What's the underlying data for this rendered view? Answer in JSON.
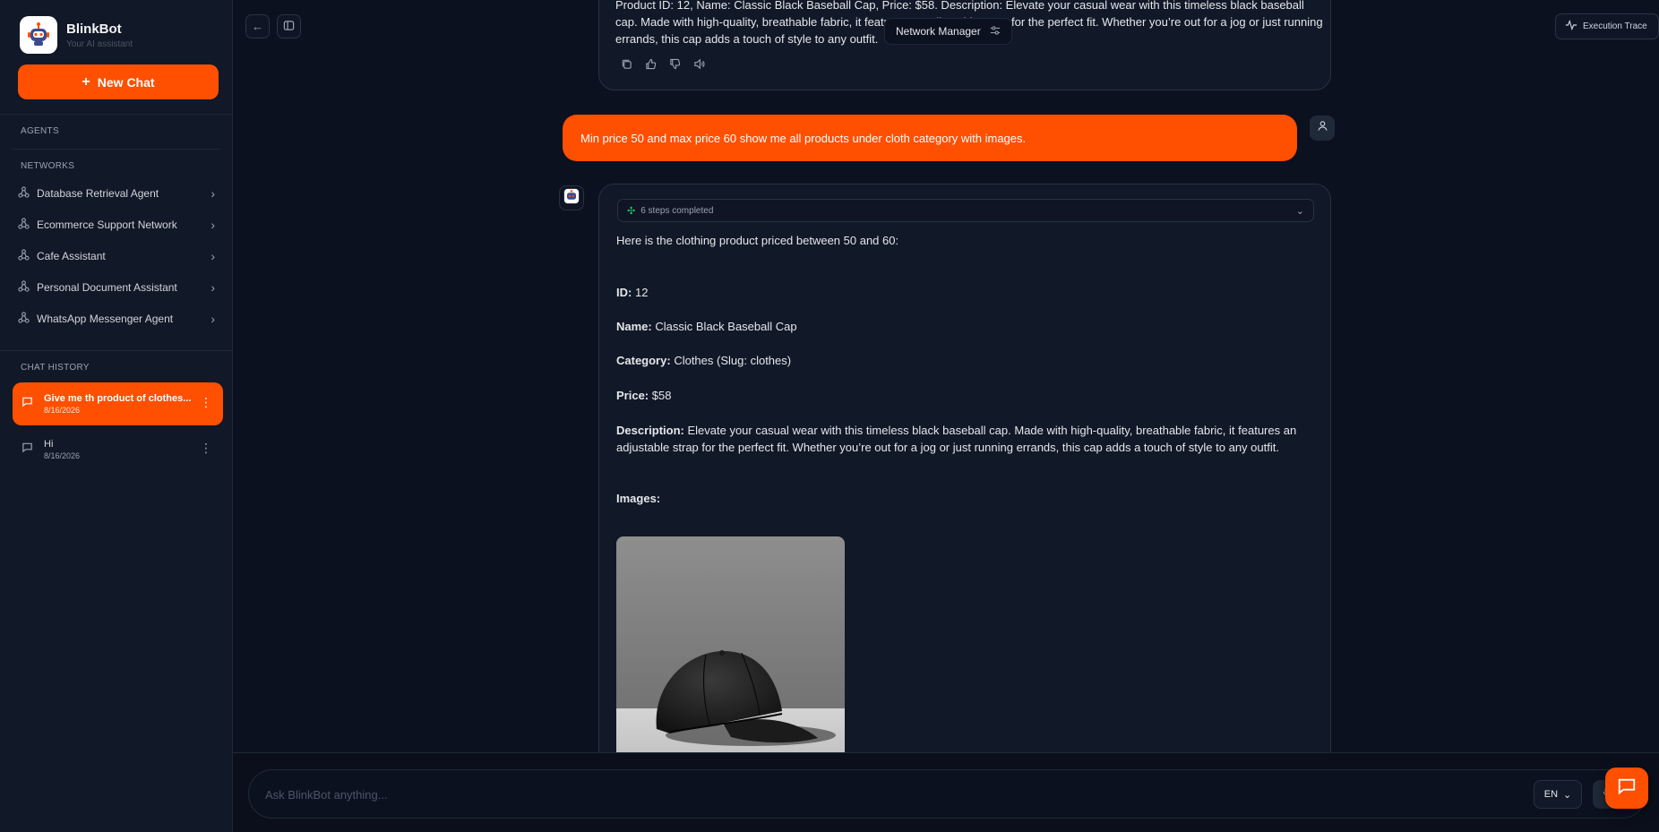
{
  "brand": {
    "name": "BlinkBot",
    "subtitle": "Your AI assistant"
  },
  "sidebar": {
    "new_chat_label": "New Chat",
    "agents_label": "AGENTS",
    "networks_label": "NETWORKS",
    "networks": [
      {
        "label": "Database Retrieval Agent"
      },
      {
        "label": "Ecommerce Support Network"
      },
      {
        "label": "Cafe Assistant"
      },
      {
        "label": "Personal Document Assistant"
      },
      {
        "label": "WhatsApp Messenger Agent"
      }
    ],
    "history_label": "CHAT HISTORY",
    "history": [
      {
        "title": "Give me th product of clothes...",
        "date": "8/16/2026"
      },
      {
        "title": "Hi",
        "date": "8/16/2026"
      }
    ]
  },
  "topbar": {
    "network_manager": "Network Manager",
    "execution_trace": "Execution Trace"
  },
  "prev_message": {
    "text": "Product ID: 12, Name: Classic Black Baseball Cap, Price: $58. Description: Elevate your casual wear with this timeless black baseball cap. Made with high-quality, breathable fabric, it features an adjustable strap for the perfect fit. Whether you’re out for a jog or just running errands, this cap adds a touch of style to any outfit."
  },
  "user_message": {
    "text": "Min price 50 and max price 60 show me all products under cloth category with images."
  },
  "response": {
    "steps": "6 steps completed",
    "intro": "Here is the clothing product priced between 50 and 60:",
    "id_label": "ID:",
    "id_value": "12",
    "name_label": "Name:",
    "name_value": "Classic Black Baseball Cap",
    "category_label": "Category:",
    "category_value": "Clothes (Slug: clothes)",
    "price_label": "Price:",
    "price_value": "$58",
    "description_label": "Description:",
    "description_value": "Elevate your casual wear with this timeless black baseball cap. Made with high-quality, breathable fabric, it features an adjustable strap for the perfect fit. Whether you’re out for a jog or just running errands, this cap adds a touch of style to any outfit.",
    "images_label": "Images:"
  },
  "input": {
    "placeholder": "Ask BlinkBot anything...",
    "language": "EN"
  },
  "colors": {
    "accent": "#ff4f00",
    "background": "#0c1120",
    "panel": "#111827"
  }
}
